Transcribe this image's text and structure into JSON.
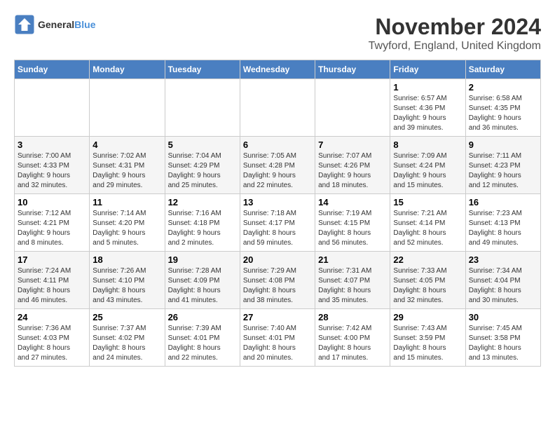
{
  "header": {
    "logo_line1": "General",
    "logo_line2": "Blue",
    "title": "November 2024",
    "subtitle": "Twyford, England, United Kingdom"
  },
  "weekdays": [
    "Sunday",
    "Monday",
    "Tuesday",
    "Wednesday",
    "Thursday",
    "Friday",
    "Saturday"
  ],
  "weeks": [
    [
      {
        "day": "",
        "info": ""
      },
      {
        "day": "",
        "info": ""
      },
      {
        "day": "",
        "info": ""
      },
      {
        "day": "",
        "info": ""
      },
      {
        "day": "",
        "info": ""
      },
      {
        "day": "1",
        "info": "Sunrise: 6:57 AM\nSunset: 4:36 PM\nDaylight: 9 hours\nand 39 minutes."
      },
      {
        "day": "2",
        "info": "Sunrise: 6:58 AM\nSunset: 4:35 PM\nDaylight: 9 hours\nand 36 minutes."
      }
    ],
    [
      {
        "day": "3",
        "info": "Sunrise: 7:00 AM\nSunset: 4:33 PM\nDaylight: 9 hours\nand 32 minutes."
      },
      {
        "day": "4",
        "info": "Sunrise: 7:02 AM\nSunset: 4:31 PM\nDaylight: 9 hours\nand 29 minutes."
      },
      {
        "day": "5",
        "info": "Sunrise: 7:04 AM\nSunset: 4:29 PM\nDaylight: 9 hours\nand 25 minutes."
      },
      {
        "day": "6",
        "info": "Sunrise: 7:05 AM\nSunset: 4:28 PM\nDaylight: 9 hours\nand 22 minutes."
      },
      {
        "day": "7",
        "info": "Sunrise: 7:07 AM\nSunset: 4:26 PM\nDaylight: 9 hours\nand 18 minutes."
      },
      {
        "day": "8",
        "info": "Sunrise: 7:09 AM\nSunset: 4:24 PM\nDaylight: 9 hours\nand 15 minutes."
      },
      {
        "day": "9",
        "info": "Sunrise: 7:11 AM\nSunset: 4:23 PM\nDaylight: 9 hours\nand 12 minutes."
      }
    ],
    [
      {
        "day": "10",
        "info": "Sunrise: 7:12 AM\nSunset: 4:21 PM\nDaylight: 9 hours\nand 8 minutes."
      },
      {
        "day": "11",
        "info": "Sunrise: 7:14 AM\nSunset: 4:20 PM\nDaylight: 9 hours\nand 5 minutes."
      },
      {
        "day": "12",
        "info": "Sunrise: 7:16 AM\nSunset: 4:18 PM\nDaylight: 9 hours\nand 2 minutes."
      },
      {
        "day": "13",
        "info": "Sunrise: 7:18 AM\nSunset: 4:17 PM\nDaylight: 8 hours\nand 59 minutes."
      },
      {
        "day": "14",
        "info": "Sunrise: 7:19 AM\nSunset: 4:15 PM\nDaylight: 8 hours\nand 56 minutes."
      },
      {
        "day": "15",
        "info": "Sunrise: 7:21 AM\nSunset: 4:14 PM\nDaylight: 8 hours\nand 52 minutes."
      },
      {
        "day": "16",
        "info": "Sunrise: 7:23 AM\nSunset: 4:13 PM\nDaylight: 8 hours\nand 49 minutes."
      }
    ],
    [
      {
        "day": "17",
        "info": "Sunrise: 7:24 AM\nSunset: 4:11 PM\nDaylight: 8 hours\nand 46 minutes."
      },
      {
        "day": "18",
        "info": "Sunrise: 7:26 AM\nSunset: 4:10 PM\nDaylight: 8 hours\nand 43 minutes."
      },
      {
        "day": "19",
        "info": "Sunrise: 7:28 AM\nSunset: 4:09 PM\nDaylight: 8 hours\nand 41 minutes."
      },
      {
        "day": "20",
        "info": "Sunrise: 7:29 AM\nSunset: 4:08 PM\nDaylight: 8 hours\nand 38 minutes."
      },
      {
        "day": "21",
        "info": "Sunrise: 7:31 AM\nSunset: 4:07 PM\nDaylight: 8 hours\nand 35 minutes."
      },
      {
        "day": "22",
        "info": "Sunrise: 7:33 AM\nSunset: 4:05 PM\nDaylight: 8 hours\nand 32 minutes."
      },
      {
        "day": "23",
        "info": "Sunrise: 7:34 AM\nSunset: 4:04 PM\nDaylight: 8 hours\nand 30 minutes."
      }
    ],
    [
      {
        "day": "24",
        "info": "Sunrise: 7:36 AM\nSunset: 4:03 PM\nDaylight: 8 hours\nand 27 minutes."
      },
      {
        "day": "25",
        "info": "Sunrise: 7:37 AM\nSunset: 4:02 PM\nDaylight: 8 hours\nand 24 minutes."
      },
      {
        "day": "26",
        "info": "Sunrise: 7:39 AM\nSunset: 4:01 PM\nDaylight: 8 hours\nand 22 minutes."
      },
      {
        "day": "27",
        "info": "Sunrise: 7:40 AM\nSunset: 4:01 PM\nDaylight: 8 hours\nand 20 minutes."
      },
      {
        "day": "28",
        "info": "Sunrise: 7:42 AM\nSunset: 4:00 PM\nDaylight: 8 hours\nand 17 minutes."
      },
      {
        "day": "29",
        "info": "Sunrise: 7:43 AM\nSunset: 3:59 PM\nDaylight: 8 hours\nand 15 minutes."
      },
      {
        "day": "30",
        "info": "Sunrise: 7:45 AM\nSunset: 3:58 PM\nDaylight: 8 hours\nand 13 minutes."
      }
    ]
  ]
}
